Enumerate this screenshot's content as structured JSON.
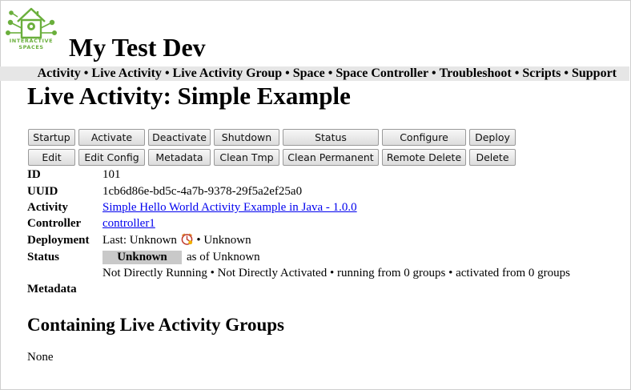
{
  "logo": {
    "line1": "INTERACTIVE",
    "line2": "SPACES",
    "icon": "house-gear-logo-icon",
    "color": "#6aaf3c"
  },
  "app_title": "My Test Dev",
  "nav": {
    "items": [
      "Activity",
      "Live Activity",
      "Live Activity Group",
      "Space",
      "Space Controller",
      "Troubleshoot",
      "Scripts",
      "Support"
    ],
    "separator": "•"
  },
  "page_title": "Live Activity: Simple Example",
  "buttons": {
    "startup": "Startup",
    "activate": "Activate",
    "deactivate": "Deactivate",
    "shutdown": "Shutdown",
    "status": "Status",
    "configure": "Configure",
    "deploy": "Deploy",
    "edit": "Edit",
    "edit_config": "Edit Config",
    "metadata": "Metadata",
    "clean_tmp": "Clean Tmp",
    "clean_permanent": "Clean Permanent",
    "remote_delete": "Remote Delete",
    "delete": "Delete"
  },
  "details": {
    "id_label": "ID",
    "id_value": "101",
    "uuid_label": "UUID",
    "uuid_value": "1cb6d86e-bd5c-4a7b-9378-29f5a2ef25a0",
    "activity_label": "Activity",
    "activity_value": "Simple Hello World Activity Example in Java - 1.0.0",
    "controller_label": "Controller",
    "controller_value": "controller1",
    "deployment_label": "Deployment",
    "deployment_prefix": "Last: Unknown",
    "deployment_suffix": "• Unknown",
    "deployment_icon": "out-of-date-clock-icon",
    "status_label": "Status",
    "status_value": "Unknown",
    "status_as_of": "as of Unknown",
    "status_detail": "Not Directly Running • Not Directly Activated • running from 0 groups • activated from 0 groups",
    "metadata_label": "Metadata"
  },
  "groups_section": {
    "title": "Containing Live Activity Groups",
    "empty_text": "None"
  },
  "colors": {
    "nav_background": "#e6e6e6",
    "status_badge_background": "#c9c9c9",
    "link": "#0000ee"
  }
}
